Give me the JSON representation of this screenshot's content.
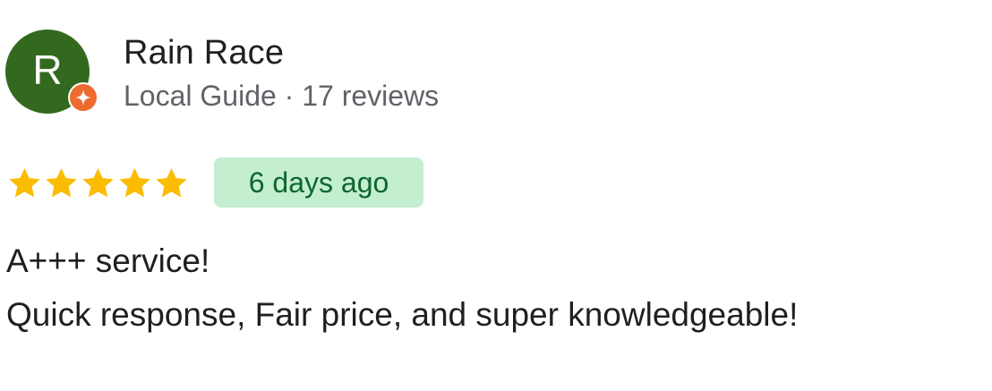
{
  "reviewer": {
    "initial": "R",
    "name": "Rain Race",
    "meta": "Local Guide · 17 reviews",
    "avatar_color": "#33691e",
    "badge_icon": "local-guide-star-icon",
    "badge_color": "#ee6b2f"
  },
  "rating": {
    "stars": 5,
    "max": 5,
    "star_color": "#fbbc04"
  },
  "date": {
    "label": "6 days ago",
    "badge_bg": "#c4eed0",
    "text_color": "#0d652d"
  },
  "review": {
    "lines": [
      "A+++ service!",
      "Quick response, Fair price, and super knowledgeable!"
    ]
  }
}
